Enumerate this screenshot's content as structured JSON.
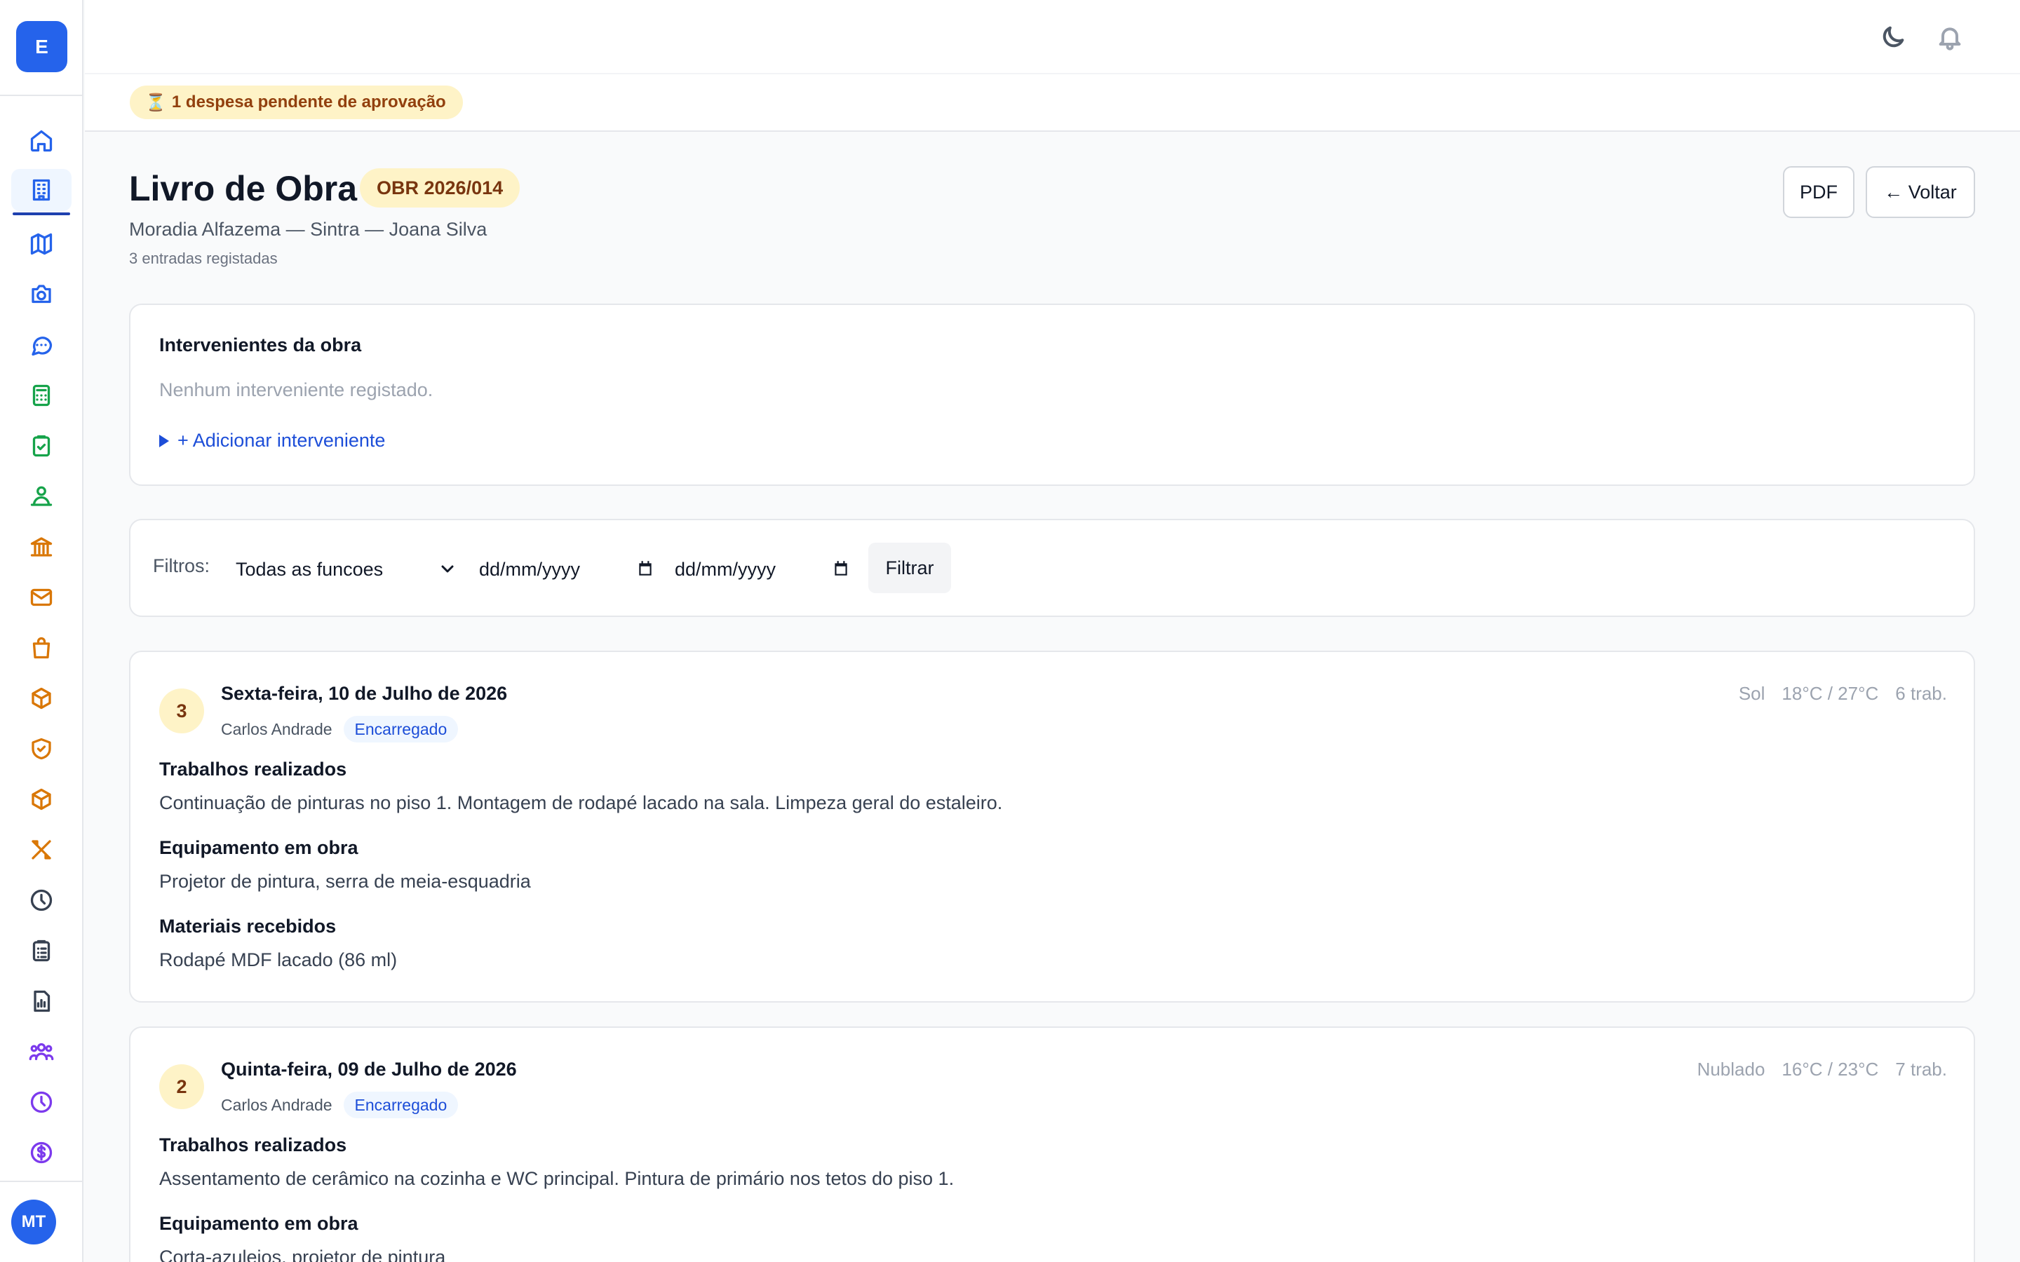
{
  "app": {
    "logo_letter": "E",
    "user_initials": "MT"
  },
  "alert": {
    "icon": "⏳",
    "text": "1 despesa pendente de aprovação"
  },
  "header": {
    "title": "Livro de Obra",
    "code": "OBR 2026/014",
    "subtitle": "Moradia Alfazema — Sintra — Joana Silva",
    "count": "3 entradas registadas",
    "pdf_label": "PDF",
    "back_label": "← Voltar"
  },
  "intervenientes": {
    "title": "Intervenientes da obra",
    "empty": "Nenhum interveniente registado.",
    "add": "+ Adicionar interveniente"
  },
  "filters": {
    "label": "Filtros:",
    "role_select": "Todas as funcoes",
    "date_from": "dd/mm/yyyy",
    "date_to": "dd/mm/yyyy",
    "button": "Filtrar"
  },
  "entries": [
    {
      "num": "3",
      "date": "Sexta-feira, 10 de Julho de 2026",
      "author": "Carlos Andrade",
      "role": "Encarregado",
      "weather": "Sol",
      "temp": "18°C / 27°C",
      "workers": "6 trab.",
      "sections": [
        {
          "title": "Trabalhos realizados",
          "text": "Continuação de pinturas no piso 1. Montagem de rodapé lacado na sala. Limpeza geral do estaleiro."
        },
        {
          "title": "Equipamento em obra",
          "text": "Projetor de pintura, serra de meia-esquadria"
        },
        {
          "title": "Materiais recebidos",
          "text": "Rodapé MDF lacado (86 ml)"
        }
      ]
    },
    {
      "num": "2",
      "date": "Quinta-feira, 09 de Julho de 2026",
      "author": "Carlos Andrade",
      "role": "Encarregado",
      "weather": "Nublado",
      "temp": "16°C / 23°C",
      "workers": "7 trab.",
      "sections": [
        {
          "title": "Trabalhos realizados",
          "text": "Assentamento de cerâmico na cozinha e WC principal. Pintura de primário nos tetos do piso 1."
        },
        {
          "title": "Equipamento em obra",
          "text": "Corta-azulejos, projetor de pintura"
        }
      ]
    }
  ],
  "colors": {
    "accent": "#2563eb",
    "badge_bg": "#fef3c7",
    "badge_text": "#78350f"
  }
}
